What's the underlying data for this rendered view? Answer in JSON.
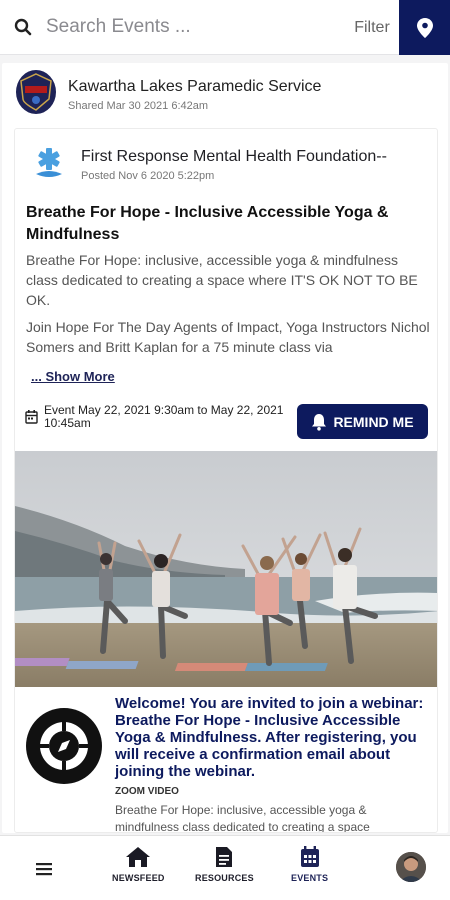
{
  "search": {
    "placeholder": "Search Events ...",
    "filter_label": "Filter"
  },
  "post": {
    "sharer_name": "Kawartha Lakes Paramedic Service",
    "shared_date": "Shared Mar 30 2021 6:42am",
    "org_name": "First Response Mental Health Foundation--",
    "org_date": "Posted Nov 6 2020 5:22pm",
    "title": "Breathe For Hope - Inclusive Accessible Yoga & Mindfulness",
    "description_1": "Breathe For Hope: inclusive, accessible yoga & mindfulness class dedicated to creating a space where IT'S OK NOT TO BE OK.",
    "description_2": "Join Hope For The Day Agents of Impact, Yoga Instructors Nichol Somers and Britt Kaplan for a 75 minute class via",
    "show_more": "... Show More",
    "event_time": "Event May 22, 2021 9:30am to May 22, 2021 10:45am",
    "remind_label": "REMIND ME",
    "webinar_title": "Welcome! You are invited to join a webinar: Breathe For Hope - Inclusive Accessible Yoga & Mindfulness. After registering, you will receive a confirmation email about joining the webinar.",
    "zoom_label": "ZOOM VIDEO",
    "webinar_desc": "Breathe For Hope: inclusive, accessible yoga & mindfulness class dedicated to creating a space"
  },
  "nav": {
    "newsfeed": "NEWSFEED",
    "resources": "RESOURCES",
    "events": "EVENTS"
  },
  "colors": {
    "accent": "#0d1a5e",
    "background": "#f4f4f5"
  }
}
